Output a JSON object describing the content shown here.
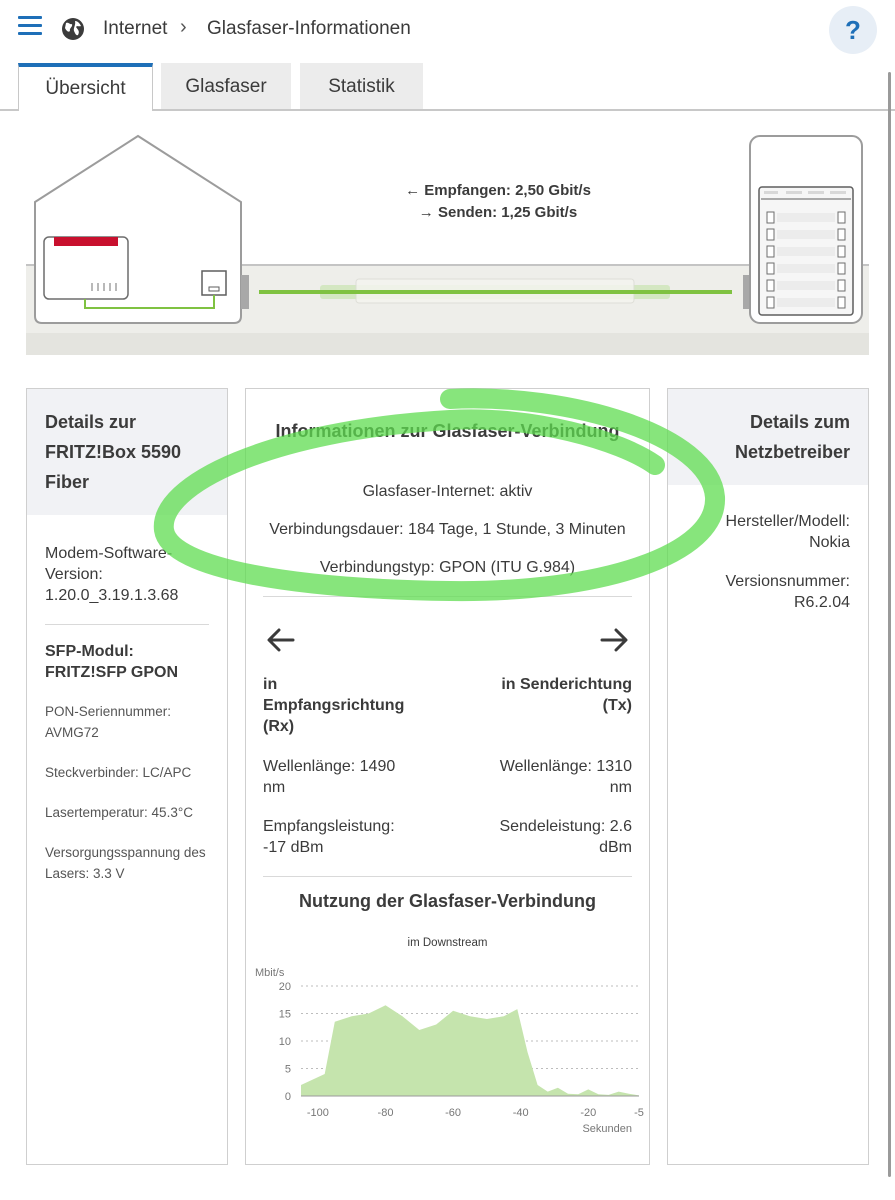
{
  "header": {
    "breadcrumb": [
      "Internet",
      "Glasfaser-Informationen"
    ],
    "help_label": "?"
  },
  "tabs": [
    {
      "label": "Übersicht",
      "active": true
    },
    {
      "label": "Glasfaser",
      "active": false
    },
    {
      "label": "Statistik",
      "active": false
    }
  ],
  "diagram": {
    "receive_label": "Empfangen: 2,50 Gbit/s",
    "send_label": "Senden: 1,25 Gbit/s"
  },
  "fritzbox_panel": {
    "title": "Details zur FRITZ!Box 5590 Fiber",
    "modem_software_label": "Modem-Software-Version:",
    "modem_software_value": "1.20.0_3.19.1.3.68",
    "sfp_title_line1": "SFP-Modul:",
    "sfp_title_line2": "FRITZ!SFP GPON",
    "pon_serial_label": "PON-Seriennummer:",
    "pon_serial_value": "AVMG72",
    "connector": "Steckverbinder: LC/APC",
    "laser_temp": "Lasertemperatur: 45.3°C",
    "laser_voltage": "Versorgungsspannung des Lasers: 3.3 V"
  },
  "fiber_panel": {
    "title": "Informationen zur Glasfaser-Verbindung",
    "status": "Glasfaser-Internet: aktiv",
    "duration": "Verbindungsdauer: 184 Tage, 1 Stunde, 3 Minuten",
    "type": "Verbindungstyp: GPON (ITU G.984)",
    "rx_title": "in Empfangsrichtung (Rx)",
    "tx_title": "in Senderichtung (Tx)",
    "rx_wavelength": "Wellenlänge: 1490 nm",
    "tx_wavelength": "Wellenlänge: 1310 nm",
    "rx_power": "Empfangsleistung: -17 dBm",
    "tx_power": "Sendeleistung: 2.6 dBm",
    "chart_title": "Nutzung der Glasfaser-Verbindung",
    "chart_subtitle": "im Downstream"
  },
  "provider_panel": {
    "title": "Details zum Netzbetreiber",
    "manufacturer_label": "Hersteller/Modell:",
    "manufacturer_value": "Nokia",
    "version_label": "Versionsnummer:",
    "version_value": "R6.2.04"
  },
  "colors": {
    "accent": "#1e6fb8",
    "chart_fill": "#c5e4ad",
    "fiber_green": "#7fc241",
    "marker_green": "#5fdc50",
    "router_red": "#c8102e"
  },
  "chart_data": {
    "type": "area",
    "title": "Nutzung der Glasfaser-Verbindung",
    "subtitle": "im Downstream",
    "ylabel": "Mbit/s",
    "xlabel": "Sekunden",
    "ylim": [
      0,
      20
    ],
    "xlim": [
      -105,
      -5
    ],
    "yticks": [
      0,
      5,
      10,
      15,
      20
    ],
    "xticks": [
      -100,
      -80,
      -60,
      -40,
      -20,
      -5
    ],
    "grid": true,
    "x": [
      -105,
      -98,
      -95,
      -90,
      -85,
      -80,
      -75,
      -70,
      -65,
      -60,
      -55,
      -50,
      -45,
      -41,
      -38,
      -35,
      -32,
      -29,
      -26,
      -23,
      -20,
      -17,
      -14,
      -11,
      -8,
      -5
    ],
    "y": [
      2,
      4,
      13.5,
      14.5,
      15,
      16.5,
      14.5,
      12,
      13,
      15.5,
      14.5,
      14,
      14.5,
      15.8,
      8,
      2,
      0.8,
      1.5,
      0.4,
      0.3,
      1.2,
      0.3,
      0.2,
      0.8,
      0.4,
      0.1
    ]
  }
}
